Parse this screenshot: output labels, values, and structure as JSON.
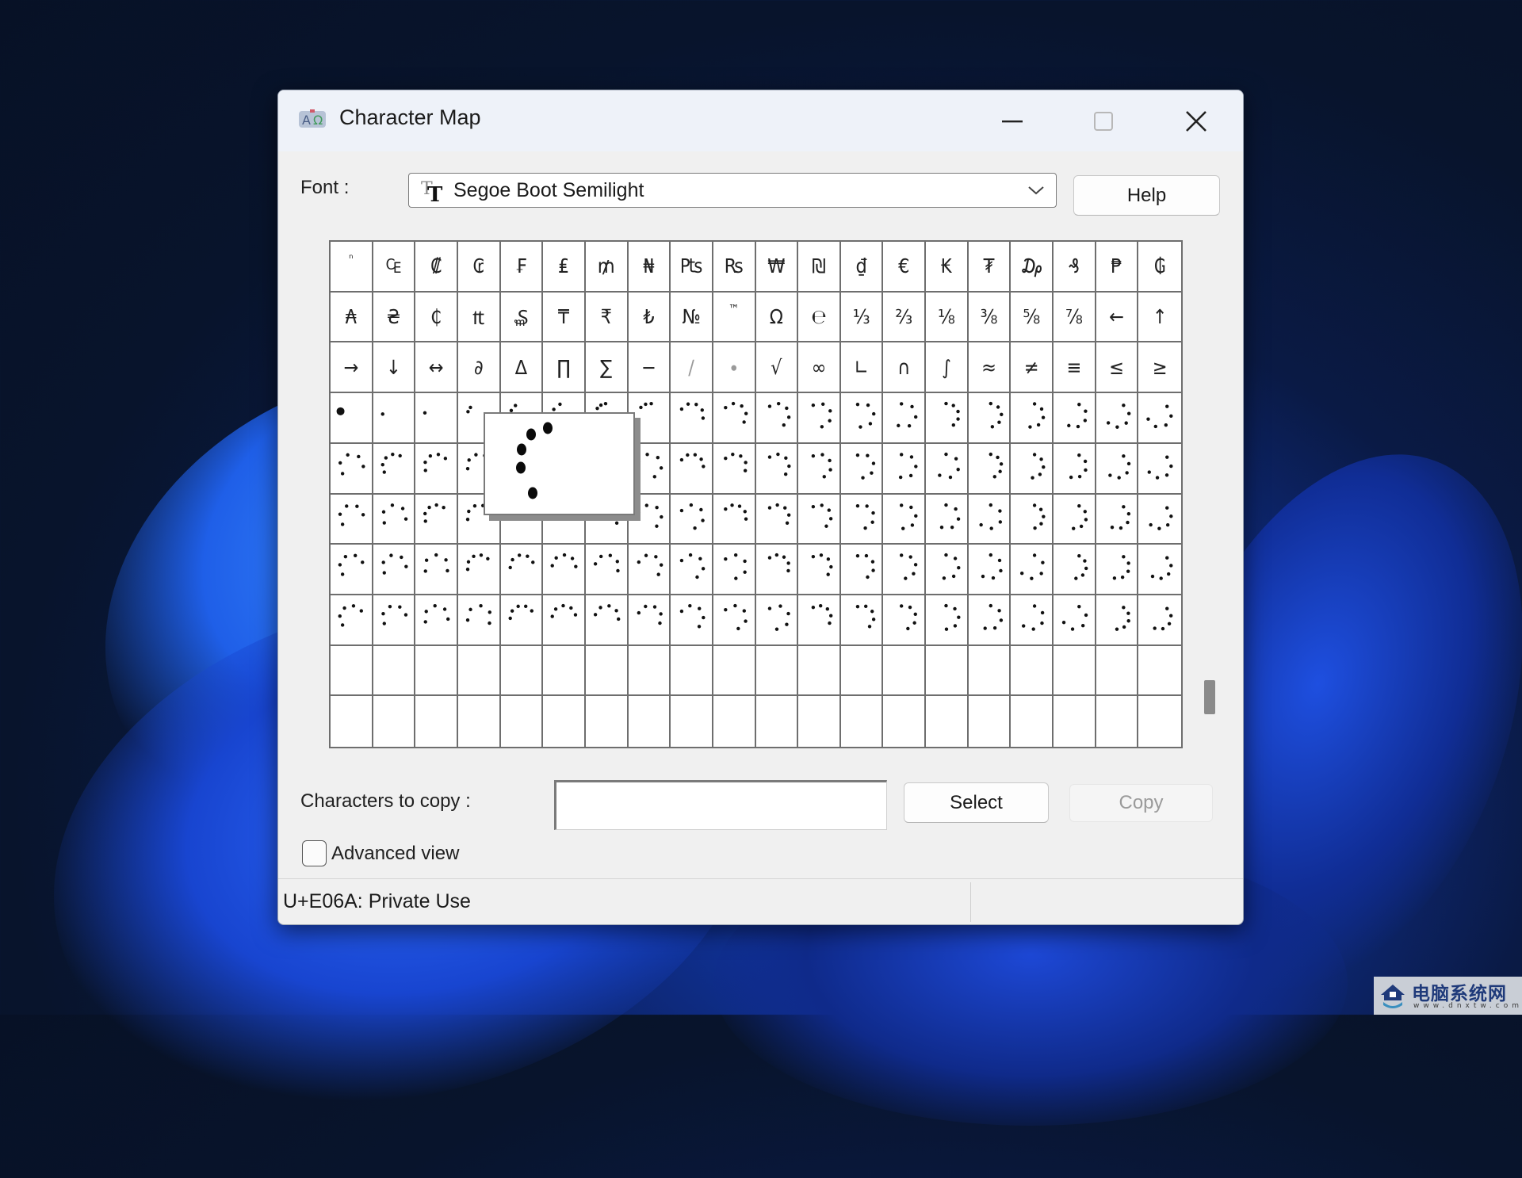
{
  "window": {
    "title": "Character Map",
    "app_icon": "charmap-app-icon",
    "controls": {
      "minimize": "minimize-icon",
      "maximize": "maximize-icon",
      "close": "close-icon",
      "maximize_enabled": false
    }
  },
  "font": {
    "label": "Font :",
    "selected": "Segoe Boot Semilight",
    "icon": "truetype-font-icon"
  },
  "buttons": {
    "help": "Help",
    "select": "Select",
    "copy": "Copy",
    "copy_enabled": false
  },
  "grid": {
    "columns": 20,
    "rows": [
      [
        "ⁿ",
        "₠",
        "₡",
        "₢",
        "₣",
        "₤",
        "₥",
        "₦",
        "₧",
        "₨",
        "₩",
        "₪",
        "₫",
        "€",
        "₭",
        "₮",
        "₯",
        "₰",
        "₱",
        "₲"
      ],
      [
        "₳",
        "₴",
        "₵",
        "₶",
        "₷",
        "₸",
        "₹",
        "₺",
        "№",
        "™",
        "Ω",
        "℮",
        "⅓",
        "⅔",
        "⅛",
        "⅜",
        "⅝",
        "⅞",
        "←",
        "↑"
      ],
      [
        "→",
        "↓",
        "↔",
        "∂",
        "∆",
        "∏",
        "∑",
        "−",
        "∕",
        "∙",
        "√",
        "∞",
        "∟",
        "∩",
        "∫",
        "≈",
        "≠",
        "≡",
        "≤",
        "≥"
      ]
    ],
    "small_glyphs": [
      "ⁿ",
      "™"
    ],
    "faint_glyphs": [
      "∕",
      "∙"
    ],
    "private_use_rows": 6,
    "private_use_cells_filled": 118,
    "empty_rows": 1,
    "private_use_glyph_kind": "spinner-dot-frame"
  },
  "enlarged_preview": {
    "codepoint": "U+E06A",
    "glyph_kind": "spinner-dot-frame",
    "frame": 24
  },
  "scrollbar": {
    "position_fraction": 0.95
  },
  "copy_field": {
    "label": "Characters to copy :",
    "value": ""
  },
  "advanced_view": {
    "label": "Advanced view",
    "checked": false
  },
  "status_bar": {
    "text": "U+E06A: Private Use"
  },
  "watermark": {
    "title": "电脑系统网",
    "url": "www.dnxtw.com"
  }
}
